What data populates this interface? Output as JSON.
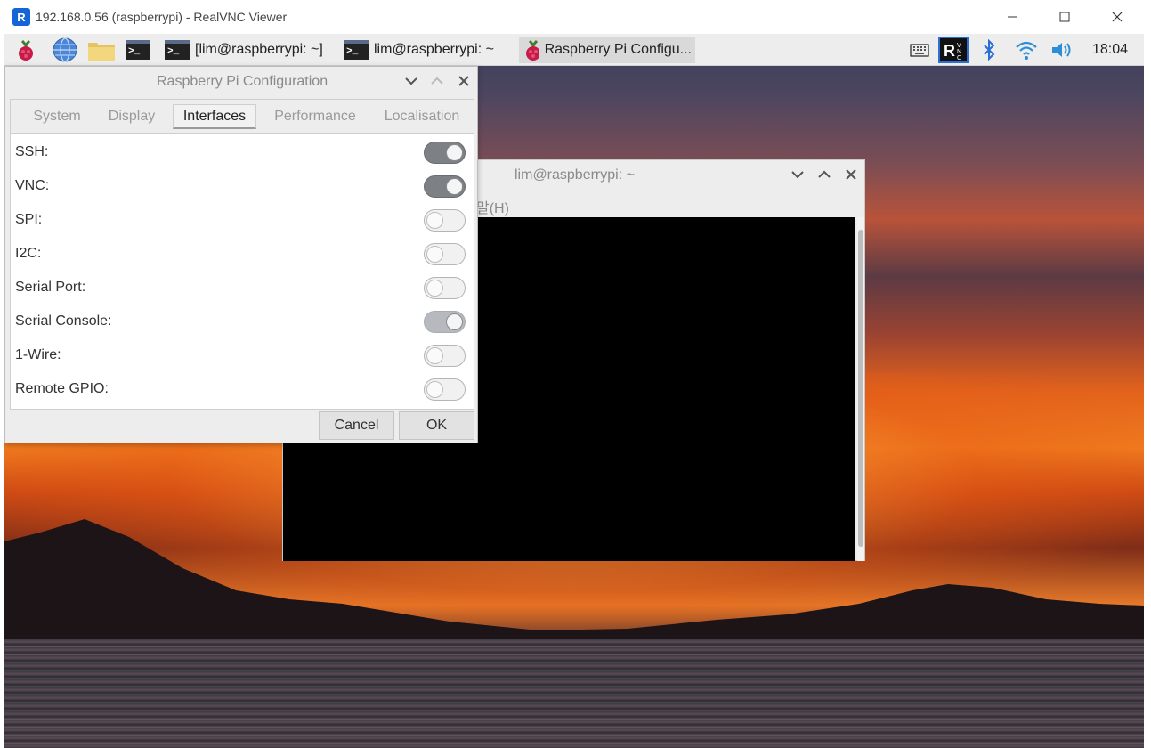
{
  "viewer": {
    "title": "192.168.0.56 (raspberrypi) - RealVNC Viewer",
    "app_icon": "realvnc-logo-icon",
    "controls": {
      "minimize": "minimize-icon",
      "maximize": "maximize-icon",
      "close": "close-icon"
    }
  },
  "taskbar": {
    "launchers": [
      "raspberry-menu-icon",
      "web-browser-icon",
      "file-manager-icon",
      "terminal-icon"
    ],
    "tasks": [
      {
        "label": "[lim@raspberrypi: ~]",
        "icon": "terminal-icon",
        "active": false
      },
      {
        "label": "lim@raspberrypi: ~",
        "icon": "terminal-icon",
        "active": false
      },
      {
        "label": "Raspberry Pi Configu...",
        "icon": "raspberry-icon",
        "active": true
      }
    ],
    "tray": [
      "keyboard-icon",
      "realvnc-icon",
      "bluetooth-icon",
      "wifi-icon",
      "volume-icon"
    ],
    "clock": "18:04"
  },
  "terminal": {
    "title": "lim@raspberrypi: ~",
    "menu_fragment": "말(H)"
  },
  "config": {
    "title": "Raspberry Pi Configuration",
    "tabs": [
      "System",
      "Display",
      "Interfaces",
      "Performance",
      "Localisation"
    ],
    "active_tab": "Interfaces",
    "settings": [
      {
        "label": "SSH:",
        "enabled": true
      },
      {
        "label": "VNC:",
        "enabled": true
      },
      {
        "label": "SPI:",
        "enabled": false
      },
      {
        "label": "I2C:",
        "enabled": false
      },
      {
        "label": "Serial Port:",
        "enabled": false
      },
      {
        "label": "Serial Console:",
        "enabled": true,
        "disabled": true
      },
      {
        "label": "1-Wire:",
        "enabled": false
      },
      {
        "label": "Remote GPIO:",
        "enabled": false
      }
    ],
    "cancel_label": "Cancel",
    "ok_label": "OK"
  }
}
